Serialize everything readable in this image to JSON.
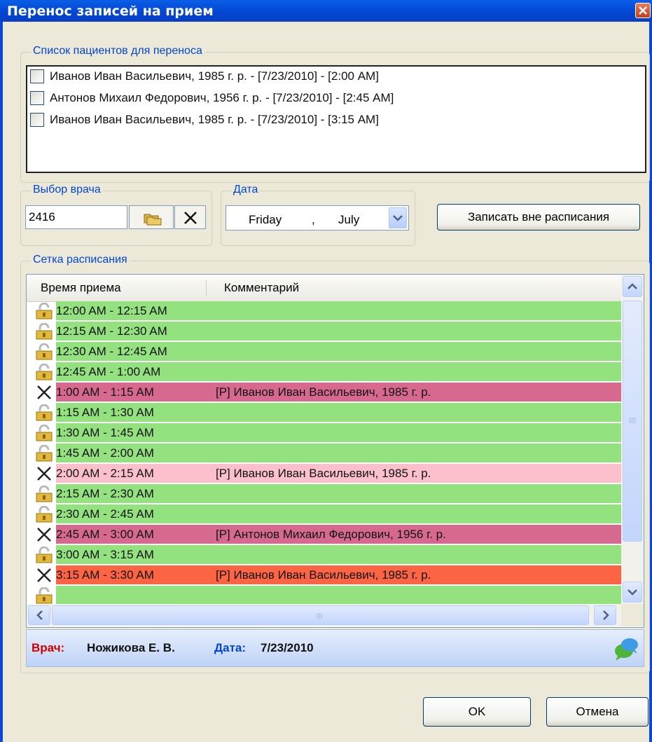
{
  "window": {
    "title": "Перенос записей на прием"
  },
  "patients": {
    "legend": "Список пациентов для переноса",
    "items": [
      {
        "label": "Иванов Иван Васильевич, 1985 г. р. - [7/23/2010] - [2:00 AM]",
        "checked": false
      },
      {
        "label": "Антонов Михаил Федорович, 1956 г. р. - [7/23/2010] - [2:45 AM]",
        "checked": false
      },
      {
        "label": "Иванов Иван Васильевич, 1985 г. р. - [7/23/2010] - [3:15 AM]",
        "checked": false
      }
    ]
  },
  "doctor": {
    "legend": "Выбор врача",
    "value": "2416"
  },
  "date": {
    "legend": "Дата",
    "weekday": "Friday",
    "separator": ",",
    "month": "July"
  },
  "off_schedule_button": "Записать вне расписания",
  "schedule": {
    "legend": "Сетка расписания",
    "columns": [
      "Время приема",
      "Комментарий"
    ],
    "rows": [
      {
        "time": "12:00 AM - 12:15 AM",
        "comment": "",
        "icon": "lock-icon",
        "color": "#93e17f"
      },
      {
        "time": "12:15 AM - 12:30 AM",
        "comment": "",
        "icon": "lock-icon",
        "color": "#93e17f"
      },
      {
        "time": "12:30 AM - 12:45 AM",
        "comment": "",
        "icon": "lock-icon",
        "color": "#93e17f"
      },
      {
        "time": "12:45 AM - 1:00 AM",
        "comment": "",
        "icon": "lock-icon",
        "color": "#93e17f"
      },
      {
        "time": "1:00 AM - 1:15 AM",
        "comment": "[Р] Иванов Иван Васильевич, 1985 г. р.",
        "icon": "cross-icon",
        "color": "#d7698e"
      },
      {
        "time": "1:15 AM - 1:30 AM",
        "comment": "",
        "icon": "lock-icon",
        "color": "#93e17f"
      },
      {
        "time": "1:30 AM - 1:45 AM",
        "comment": "",
        "icon": "lock-icon",
        "color": "#93e17f"
      },
      {
        "time": "1:45 AM - 2:00 AM",
        "comment": "",
        "icon": "lock-icon",
        "color": "#93e17f"
      },
      {
        "time": "2:00 AM - 2:15 AM",
        "comment": "[Р] Иванов Иван Васильевич, 1985 г. р.",
        "icon": "cross-icon",
        "color": "#fbc0cb"
      },
      {
        "time": "2:15 AM - 2:30 AM",
        "comment": "",
        "icon": "lock-icon",
        "color": "#93e17f"
      },
      {
        "time": "2:30 AM - 2:45 AM",
        "comment": "",
        "icon": "lock-icon",
        "color": "#93e17f"
      },
      {
        "time": "2:45 AM - 3:00 AM",
        "comment": "[Р] Антонов Михаил Федорович, 1956 г. р.",
        "icon": "cross-icon",
        "color": "#d7698e"
      },
      {
        "time": "3:00 AM - 3:15 AM",
        "comment": "",
        "icon": "lock-icon",
        "color": "#93e17f"
      },
      {
        "time": "3:15 AM - 3:30 AM",
        "comment": "[Р] Иванов Иван Васильевич, 1985 г. р.",
        "icon": "cross-icon",
        "color": "#fc6443"
      },
      {
        "time": "",
        "comment": "",
        "icon": "lock-icon",
        "color": "#93e17f"
      }
    ]
  },
  "status": {
    "doctor_label": "Врач:",
    "doctor_value": "Ножикова Е. В.",
    "date_label": "Дата:",
    "date_value": "7/23/2010"
  },
  "buttons": {
    "ok": "OK",
    "cancel": "Отмена"
  },
  "colors": {
    "doctor_label": "#d20000",
    "date_label": "#0046d5",
    "accent": "#0a46d8"
  }
}
